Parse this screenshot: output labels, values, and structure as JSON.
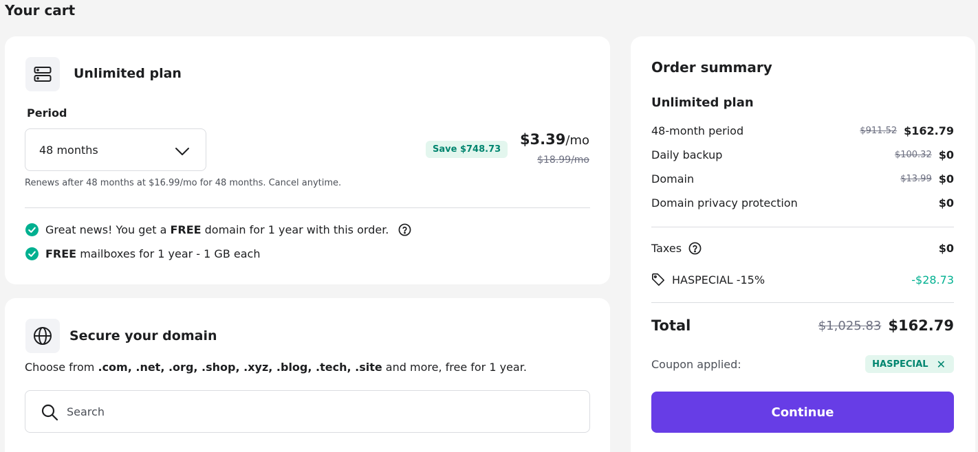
{
  "page": {
    "title": "Your cart"
  },
  "plan": {
    "title": "Unlimited plan",
    "period_label": "Period",
    "period_value": "48 months",
    "renew_note": "Renews after 48 months at $16.99/mo for 48 months. Cancel anytime.",
    "save_badge": "Save $748.73",
    "price_now": "$3.39",
    "price_unit": "/mo",
    "price_old": "$18.99/mo",
    "features": [
      {
        "pre": "Great news! You get a ",
        "bold": "FREE",
        "post": " domain for 1 year with this order."
      },
      {
        "pre": "",
        "bold": "FREE",
        "post": " mailboxes for 1 year - 1 GB each"
      }
    ]
  },
  "domain": {
    "title": "Secure your domain",
    "desc_pre": "Choose from ",
    "tlds": ".com, .net, .org, .shop, .xyz, .blog, .tech, .site",
    "desc_post": " and more, free for 1 year.",
    "search_placeholder": "Search"
  },
  "summary": {
    "title": "Order summary",
    "plan_name": "Unlimited plan",
    "rows": [
      {
        "label": "48-month period",
        "old": "$911.52",
        "value": "$162.79"
      },
      {
        "label": "Daily backup",
        "old": "$100.32",
        "value": "$0"
      },
      {
        "label": "Domain",
        "old": "$13.99",
        "value": "$0"
      },
      {
        "label": "Domain privacy protection",
        "old": "",
        "value": "$0"
      }
    ],
    "taxes_label": "Taxes",
    "taxes_value": "$0",
    "coupon_label": "HASPECIAL -15%",
    "coupon_value": "-$28.73",
    "total_label": "Total",
    "total_old": "$1,025.83",
    "total_value": "$162.79",
    "applied_label": "Coupon applied:",
    "applied_code": "HASPECIAL",
    "continue_label": "Continue"
  },
  "colors": {
    "accent": "#673de6",
    "success": "#00b090",
    "badge_bg": "#e3f6ee"
  },
  "icons": [
    "server-icon",
    "chevron-down-icon",
    "check-circle-icon",
    "help-circle-icon",
    "globe-icon",
    "search-icon",
    "tag-icon",
    "close-icon"
  ]
}
